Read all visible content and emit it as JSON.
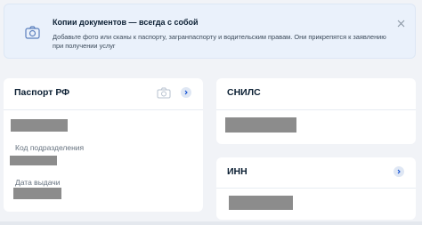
{
  "banner": {
    "title": "Копии документов — всегда с собой",
    "text": "Добавьте фото или сканы к паспорту, загранпаспорту и водительским правам. Они прикрепятся к заявлению при получении услуг"
  },
  "passport": {
    "title": "Паспорт РФ",
    "subdivision_label": "Код подразделения",
    "issue_date_label": "Дата выдачи"
  },
  "snils": {
    "title": "СНИЛС"
  },
  "inn": {
    "title": "ИНН"
  },
  "colors": {
    "accent": "#0d4cd3",
    "banner_bg": "#eaf1fb",
    "redaction": "#8c8c8c"
  }
}
